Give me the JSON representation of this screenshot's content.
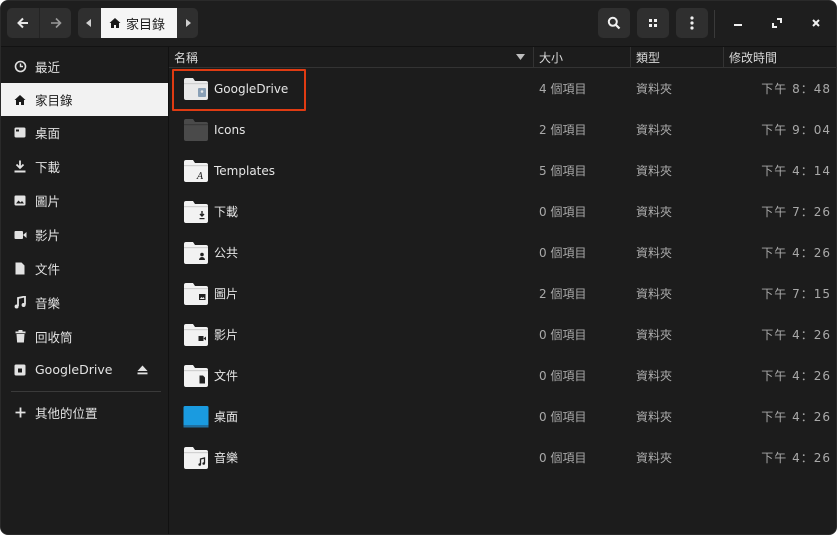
{
  "header": {
    "path_home_label": "家目錄"
  },
  "sidebar": {
    "items": [
      {
        "label": "最近",
        "icon": "clock-icon"
      },
      {
        "label": "家目錄",
        "icon": "home-icon"
      },
      {
        "label": "桌面",
        "icon": "desktop-icon"
      },
      {
        "label": "下載",
        "icon": "download-icon"
      },
      {
        "label": "圖片",
        "icon": "image-icon"
      },
      {
        "label": "影片",
        "icon": "video-icon"
      },
      {
        "label": "文件",
        "icon": "document-icon"
      },
      {
        "label": "音樂",
        "icon": "music-icon"
      },
      {
        "label": "回收筒",
        "icon": "trash-icon"
      },
      {
        "label": "GoogleDrive",
        "icon": "drive-icon"
      },
      {
        "label": "其他的位置",
        "icon": "plus-icon"
      }
    ]
  },
  "columns": {
    "name": "名稱",
    "size": "大小",
    "type": "類型",
    "modified": "修改時間"
  },
  "files": [
    {
      "name": "GoogleDrive",
      "size": "4 個項目",
      "type": "資料夾",
      "time": "下午 8：48",
      "icon": "drive-folder-icon"
    },
    {
      "name": "Icons",
      "size": "2 個項目",
      "type": "資料夾",
      "time": "下午 9：04",
      "icon": "dark-folder-icon"
    },
    {
      "name": "Templates",
      "size": "5 個項目",
      "type": "資料夾",
      "time": "下午 4：14",
      "icon": "templates-folder-icon"
    },
    {
      "name": "下載",
      "size": "0 個項目",
      "type": "資料夾",
      "time": "下午 7：26",
      "icon": "download-folder-icon"
    },
    {
      "name": "公共",
      "size": "0 個項目",
      "type": "資料夾",
      "time": "下午 4：26",
      "icon": "public-folder-icon"
    },
    {
      "name": "圖片",
      "size": "2 個項目",
      "type": "資料夾",
      "time": "下午 7：15",
      "icon": "pictures-folder-icon"
    },
    {
      "name": "影片",
      "size": "0 個項目",
      "type": "資料夾",
      "time": "下午 4：26",
      "icon": "videos-folder-icon"
    },
    {
      "name": "文件",
      "size": "0 個項目",
      "type": "資料夾",
      "time": "下午 4：26",
      "icon": "documents-folder-icon"
    },
    {
      "name": "桌面",
      "size": "0 個項目",
      "type": "資料夾",
      "time": "下午 4：26",
      "icon": "desktop-folder-icon"
    },
    {
      "name": "音樂",
      "size": "0 個項目",
      "type": "資料夾",
      "time": "下午 4：26",
      "icon": "music-folder-icon"
    }
  ],
  "colors": {
    "window_bg": "#1c1c1c",
    "highlight_box": "#e03b12",
    "desktop_folder": "#1a9be0"
  }
}
